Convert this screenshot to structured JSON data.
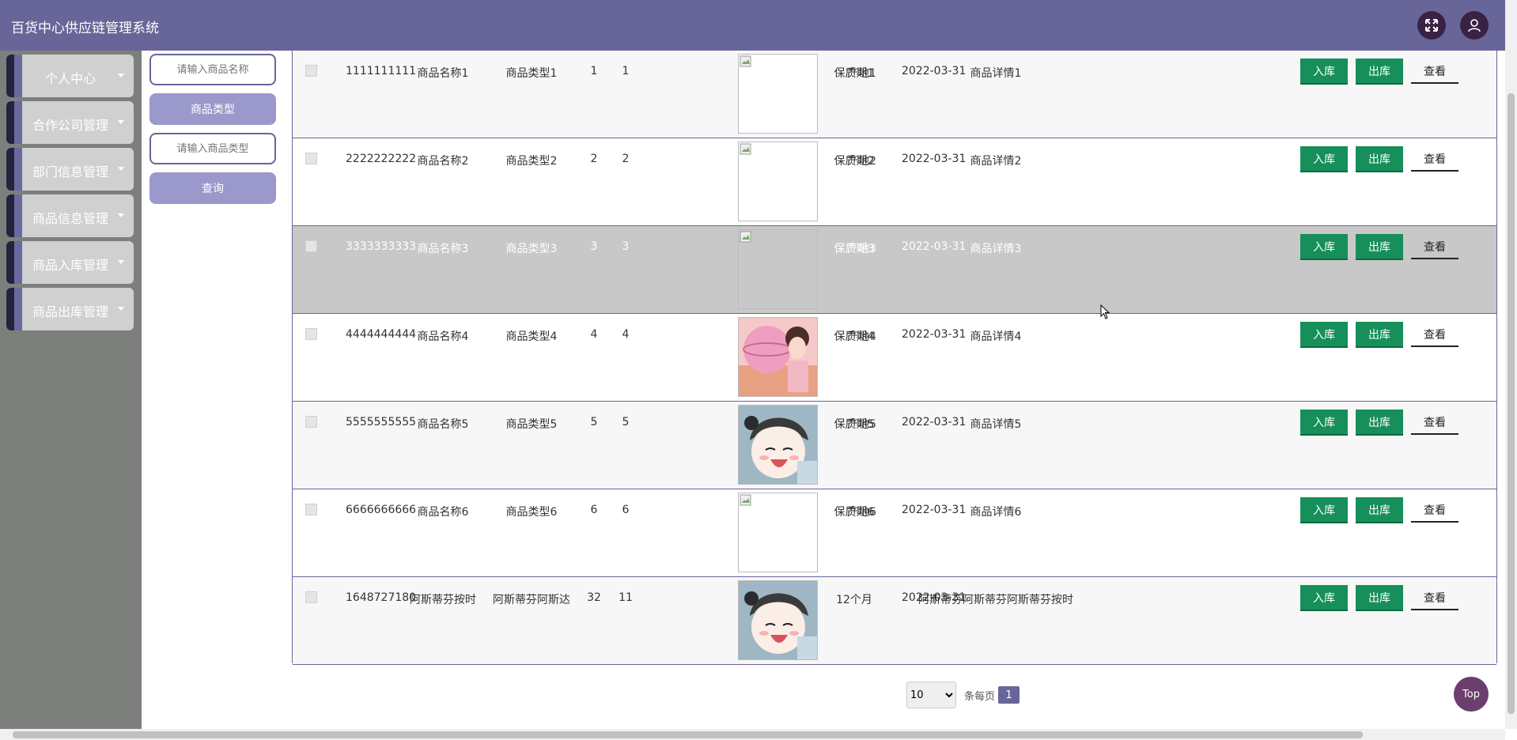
{
  "app": {
    "title": "百货中心供应链管理系统"
  },
  "sidebar": {
    "items": [
      {
        "label": "个人中心"
      },
      {
        "label": "合作公司管理"
      },
      {
        "label": "部门信息管理"
      },
      {
        "label": "商品信息管理"
      },
      {
        "label": "商品入库管理"
      },
      {
        "label": "商品出库管理"
      }
    ]
  },
  "filter": {
    "name_placeholder": "请输入商品名称",
    "type_label": "商品类型",
    "type_placeholder": "请输入商品类型",
    "query_label": "查询"
  },
  "table": {
    "actions": {
      "in": "入库",
      "out": "出库",
      "view": "查看"
    },
    "rows": [
      {
        "id": "1111111111",
        "name": "商品名称1",
        "type": "商品类型1",
        "a": "1",
        "b": "1",
        "origin": "产地1",
        "date": "2022-03-31",
        "shelf": "保质期1",
        "detail": "商品详情1",
        "image": "broken"
      },
      {
        "id": "2222222222",
        "name": "商品名称2",
        "type": "商品类型2",
        "a": "2",
        "b": "2",
        "origin": "产地2",
        "date": "2022-03-31",
        "shelf": "保质期2",
        "detail": "商品详情2",
        "image": "broken"
      },
      {
        "id": "3333333333",
        "name": "商品名称3",
        "type": "商品类型3",
        "a": "3",
        "b": "3",
        "origin": "产地3",
        "date": "2022-03-31",
        "shelf": "保质期3",
        "detail": "商品详情3",
        "image": "broken"
      },
      {
        "id": "4444444444",
        "name": "商品名称4",
        "type": "商品类型4",
        "a": "4",
        "b": "4",
        "origin": "产地4",
        "date": "2022-03-31",
        "shelf": "保质期4",
        "detail": "商品详情4",
        "image": "photo-pink"
      },
      {
        "id": "5555555555",
        "name": "商品名称5",
        "type": "商品类型5",
        "a": "5",
        "b": "5",
        "origin": "产地5",
        "date": "2022-03-31",
        "shelf": "保质期5",
        "detail": "商品详情5",
        "image": "photo-anime"
      },
      {
        "id": "6666666666",
        "name": "商品名称6",
        "type": "商品类型6",
        "a": "6",
        "b": "6",
        "origin": "产地6",
        "date": "2022-03-31",
        "shelf": "保质期6",
        "detail": "商品详情6",
        "image": "broken"
      },
      {
        "id": "1648727180",
        "name": "阿斯蒂芬按时",
        "type": "阿斯蒂芬阿斯达",
        "a": "32",
        "b": "11",
        "origin": "",
        "date": "2022-03-31",
        "shelf": "12个月",
        "detail": "阿斯蒂芬阿斯蒂芬阿斯蒂芬按时",
        "image": "photo-anime"
      }
    ]
  },
  "pager": {
    "page_size": "10",
    "per_page_label": "条每页",
    "current_page": "1"
  },
  "top_button": "Top",
  "colors": {
    "header": "#686599",
    "sidebar": "#7d7f7d",
    "action_green": "#168f5a",
    "hover_row": "#c8c8c8"
  }
}
